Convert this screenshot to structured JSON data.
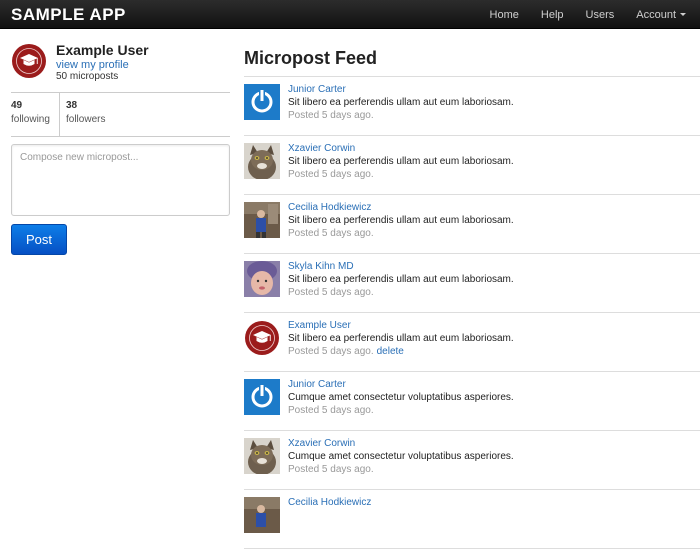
{
  "navbar": {
    "brand": "SAMPLE APP",
    "links": [
      {
        "label": "Home"
      },
      {
        "label": "Help"
      },
      {
        "label": "Users"
      },
      {
        "label": "Account"
      }
    ]
  },
  "sidebar": {
    "user_name": "Example User",
    "profile_link": "view my profile",
    "micropost_count": "50 microposts",
    "following_count": "49",
    "following_label": "following",
    "followers_count": "38",
    "followers_label": "followers",
    "compose_placeholder": "Compose new micropost...",
    "post_button": "Post"
  },
  "feed": {
    "title": "Micropost Feed",
    "items": [
      {
        "user": "Junior Carter",
        "content": "Sit libero ea perferendis ullam aut eum laboriosam.",
        "time": "Posted 5 days ago.",
        "avatar": "power-icon"
      },
      {
        "user": "Xzavier Corwin",
        "content": "Sit libero ea perferendis ullam aut eum laboriosam.",
        "time": "Posted 5 days ago.",
        "avatar": "cat-photo"
      },
      {
        "user": "Cecilia Hodkiewicz",
        "content": "Sit libero ea perferendis ullam aut eum laboriosam.",
        "time": "Posted 5 days ago.",
        "avatar": "person-photo"
      },
      {
        "user": "Skyla Kihn MD",
        "content": "Sit libero ea perferendis ullam aut eum laboriosam.",
        "time": "Posted 5 days ago.",
        "avatar": "baby-photo"
      },
      {
        "user": "Example User",
        "content": "Sit libero ea perferendis ullam aut eum laboriosam.",
        "time": "Posted 5 days ago.",
        "delete": "delete",
        "avatar": "seal-icon"
      },
      {
        "user": "Junior Carter",
        "content": "Cumque amet consectetur voluptatibus asperiores.",
        "time": "Posted 5 days ago.",
        "avatar": "power-icon"
      },
      {
        "user": "Xzavier Corwin",
        "content": "Cumque amet consectetur voluptatibus asperiores.",
        "time": "Posted 5 days ago.",
        "avatar": "cat-photo"
      },
      {
        "user": "Cecilia Hodkiewicz",
        "content": "",
        "time": "",
        "avatar": "person-photo"
      }
    ]
  },
  "colors": {
    "navbar": "#1b1b1b",
    "link": "#2a6fb6",
    "button": "#0a6ad6",
    "seal": "#9b1c1c"
  }
}
